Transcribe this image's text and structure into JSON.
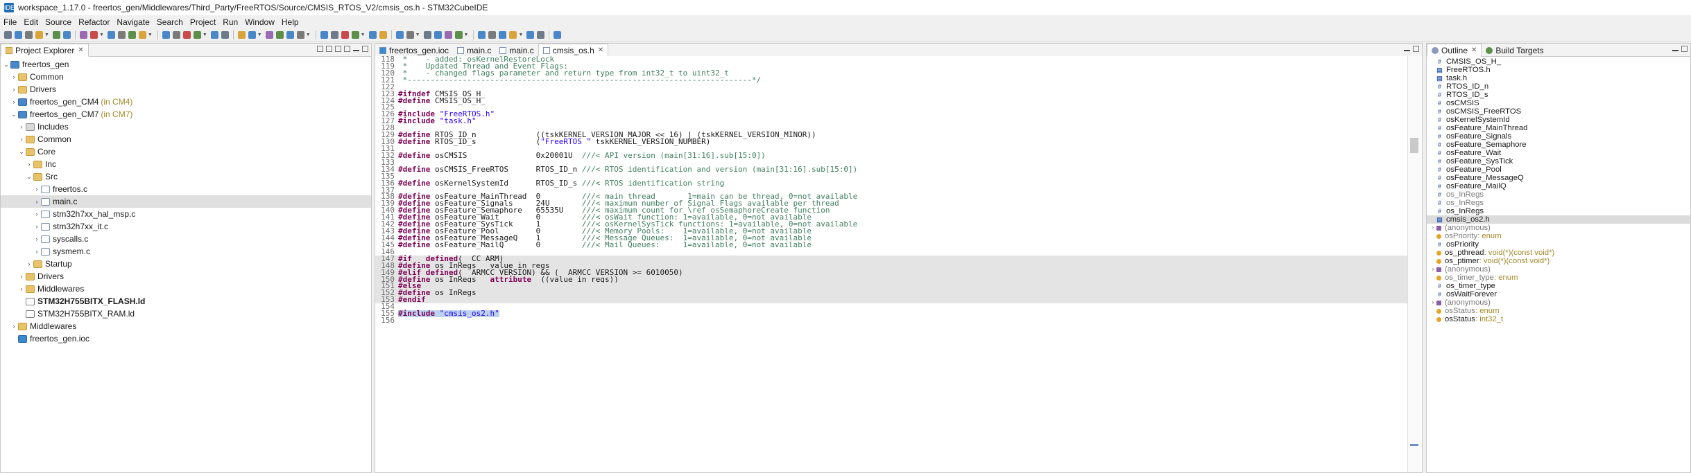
{
  "window": {
    "title": "workspace_1.17.0 - freertos_gen/Middlewares/Third_Party/FreeRTOS/Source/CMSIS_RTOS_V2/cmsis_os.h - STM32CubeIDE"
  },
  "menu": [
    "File",
    "Edit",
    "Source",
    "Refactor",
    "Navigate",
    "Search",
    "Project",
    "Run",
    "Window",
    "Help"
  ],
  "project_explorer": {
    "tab_label": "Project Explorer",
    "items": [
      {
        "label": "freertos_gen",
        "depth": 0,
        "type": "proj",
        "tw": "v",
        "suffix": ""
      },
      {
        "label": "Common",
        "depth": 1,
        "type": "folder",
        "tw": ">",
        "suffix": ""
      },
      {
        "label": "Drivers",
        "depth": 1,
        "type": "folder",
        "tw": ">",
        "suffix": ""
      },
      {
        "label": "freertos_gen_CM4",
        "depth": 1,
        "type": "proj",
        "tw": ">",
        "suffix": "(in CM4)"
      },
      {
        "label": "freertos_gen_CM7",
        "depth": 1,
        "type": "proj",
        "tw": "v",
        "suffix": "(in CM7)"
      },
      {
        "label": "Includes",
        "depth": 2,
        "type": "incfolder",
        "tw": ">",
        "suffix": ""
      },
      {
        "label": "Common",
        "depth": 2,
        "type": "folder",
        "tw": ">",
        "suffix": ""
      },
      {
        "label": "Core",
        "depth": 2,
        "type": "folder",
        "tw": "v",
        "suffix": ""
      },
      {
        "label": "Inc",
        "depth": 3,
        "type": "folder",
        "tw": ">",
        "suffix": ""
      },
      {
        "label": "Src",
        "depth": 3,
        "type": "folder",
        "tw": "v",
        "suffix": ""
      },
      {
        "label": "freertos.c",
        "depth": 4,
        "type": "cfile",
        "tw": ">",
        "suffix": ""
      },
      {
        "label": "main.c",
        "depth": 4,
        "type": "cfile",
        "tw": ">",
        "suffix": "",
        "selected": true
      },
      {
        "label": "stm32h7xx_hal_msp.c",
        "depth": 4,
        "type": "cfile",
        "tw": ">",
        "suffix": ""
      },
      {
        "label": "stm32h7xx_it.c",
        "depth": 4,
        "type": "cfile",
        "tw": ">",
        "suffix": ""
      },
      {
        "label": "syscalls.c",
        "depth": 4,
        "type": "cfile",
        "tw": ">",
        "suffix": ""
      },
      {
        "label": "sysmem.c",
        "depth": 4,
        "type": "cfile",
        "tw": ">",
        "suffix": ""
      },
      {
        "label": "Startup",
        "depth": 3,
        "type": "folder",
        "tw": ">",
        "suffix": ""
      },
      {
        "label": "Drivers",
        "depth": 2,
        "type": "folder",
        "tw": ">",
        "suffix": ""
      },
      {
        "label": "Middlewares",
        "depth": 2,
        "type": "folder",
        "tw": ">",
        "suffix": ""
      },
      {
        "label": "STM32H755BITX_FLASH.ld",
        "depth": 2,
        "type": "ldfile",
        "tw": "",
        "suffix": "",
        "bold": true
      },
      {
        "label": "STM32H755BITX_RAM.ld",
        "depth": 2,
        "type": "ldfile",
        "tw": "",
        "suffix": ""
      },
      {
        "label": "Middlewares",
        "depth": 1,
        "type": "folder",
        "tw": ">",
        "suffix": ""
      },
      {
        "label": "freertos_gen.ioc",
        "depth": 1,
        "type": "iocfile",
        "tw": "",
        "suffix": ""
      }
    ]
  },
  "editor": {
    "tabs": [
      {
        "label": "freertos_gen.ioc",
        "active": false,
        "closable": false
      },
      {
        "label": "main.c",
        "active": false,
        "closable": false
      },
      {
        "label": "main.c",
        "active": false,
        "closable": false
      },
      {
        "label": "cmsis_os.h",
        "active": true,
        "closable": true
      }
    ],
    "lines": [
      {
        "n": "118",
        "t": " *    - added: osKernelRestoreLock"
      },
      {
        "n": "119",
        "t": " *    Updated Thread and Event Flags:"
      },
      {
        "n": "120",
        "t": " *    - changed flags parameter and return type from int32_t to uint32_t"
      },
      {
        "n": "121",
        "t": " *---------------------------------------------------------------------------*/"
      },
      {
        "n": "122",
        "t": ""
      },
      {
        "n": "123",
        "t": "#ifndef CMSIS_OS_H_"
      },
      {
        "n": "124",
        "t": "#define CMSIS_OS_H_"
      },
      {
        "n": "125",
        "t": ""
      },
      {
        "n": "126",
        "t": "#include \"FreeRTOS.h\""
      },
      {
        "n": "127",
        "t": "#include \"task.h\""
      },
      {
        "n": "128",
        "t": ""
      },
      {
        "n": "129",
        "t": "#define RTOS_ID_n             ((tskKERNEL_VERSION_MAJOR << 16) | (tskKERNEL_VERSION_MINOR))"
      },
      {
        "n": "130",
        "t": "#define RTOS_ID_s             (\"FreeRTOS \" tskKERNEL_VERSION_NUMBER)"
      },
      {
        "n": "131",
        "t": ""
      },
      {
        "n": "132",
        "t": "#define osCMSIS               0x20001U  ///< API version (main[31:16].sub[15:0])"
      },
      {
        "n": "133",
        "t": ""
      },
      {
        "n": "134",
        "t": "#define osCMSIS_FreeRTOS      RTOS_ID_n ///< RTOS identification and version (main[31:16].sub[15:0])"
      },
      {
        "n": "135",
        "t": ""
      },
      {
        "n": "136",
        "t": "#define osKernelSystemId      RTOS_ID_s ///< RTOS identification string"
      },
      {
        "n": "137",
        "t": ""
      },
      {
        "n": "138",
        "t": "#define osFeature_MainThread  0         ///< main thread       1=main can be thread, 0=not available"
      },
      {
        "n": "139",
        "t": "#define osFeature_Signals     24U       ///< maximum number of Signal Flags available per thread"
      },
      {
        "n": "140",
        "t": "#define osFeature_Semaphore   65535U    ///< maximum count for \\ref osSemaphoreCreate function"
      },
      {
        "n": "141",
        "t": "#define osFeature_Wait        0         ///< osWait function: 1=available, 0=not available"
      },
      {
        "n": "142",
        "t": "#define osFeature_SysTick     1         ///< osKernelSysTick functions: 1=available, 0=not available"
      },
      {
        "n": "143",
        "t": "#define osFeature_Pool        0         ///< Memory Pools:    1=available, 0=not available"
      },
      {
        "n": "144",
        "t": "#define osFeature_MessageQ    1         ///< Message Queues:  1=available, 0=not available"
      },
      {
        "n": "145",
        "t": "#define osFeature_MailQ       0         ///< Mail Queues:     1=available, 0=not available"
      },
      {
        "n": "146",
        "t": ""
      },
      {
        "n": "147",
        "t": "#if   defined(__CC_ARM)"
      },
      {
        "n": "148",
        "t": "#define os_InRegs __value_in_regs"
      },
      {
        "n": "149",
        "t": "#elif defined(__ARMCC_VERSION) && (__ARMCC_VERSION >= 6010050)"
      },
      {
        "n": "150",
        "t": "#define os_InRegs __attribute__((value_in_regs))"
      },
      {
        "n": "151",
        "t": "#else"
      },
      {
        "n": "152",
        "t": "#define os_InRegs"
      },
      {
        "n": "153",
        "t": "#endif"
      },
      {
        "n": "154",
        "t": ""
      },
      {
        "n": "155",
        "t": "#include \"cmsis_os2.h\""
      },
      {
        "n": "156",
        "t": ""
      }
    ]
  },
  "outline": {
    "tabs": [
      "Outline",
      "Build Targets"
    ],
    "items": [
      {
        "icon": "#",
        "label": "CMSIS_OS_H_",
        "type": "",
        "gray": false
      },
      {
        "icon": "inc",
        "label": "FreeRTOS.h",
        "type": "",
        "gray": false
      },
      {
        "icon": "inc",
        "label": "task.h",
        "type": "",
        "gray": false
      },
      {
        "icon": "#",
        "label": "RTOS_ID_n",
        "type": "",
        "gray": false
      },
      {
        "icon": "#",
        "label": "RTOS_ID_s",
        "type": "",
        "gray": false
      },
      {
        "icon": "#",
        "label": "osCMSIS",
        "type": "",
        "gray": false
      },
      {
        "icon": "#",
        "label": "osCMSIS_FreeRTOS",
        "type": "",
        "gray": false
      },
      {
        "icon": "#",
        "label": "osKernelSystemId",
        "type": "",
        "gray": false
      },
      {
        "icon": "#",
        "label": "osFeature_MainThread",
        "type": "",
        "gray": false
      },
      {
        "icon": "#",
        "label": "osFeature_Signals",
        "type": "",
        "gray": false
      },
      {
        "icon": "#",
        "label": "osFeature_Semaphore",
        "type": "",
        "gray": false
      },
      {
        "icon": "#",
        "label": "osFeature_Wait",
        "type": "",
        "gray": false
      },
      {
        "icon": "#",
        "label": "osFeature_SysTick",
        "type": "",
        "gray": false
      },
      {
        "icon": "#",
        "label": "osFeature_Pool",
        "type": "",
        "gray": false
      },
      {
        "icon": "#",
        "label": "osFeature_MessageQ",
        "type": "",
        "gray": false
      },
      {
        "icon": "#",
        "label": "osFeature_MailQ",
        "type": "",
        "gray": false
      },
      {
        "icon": "#",
        "label": "os_InRegs",
        "type": "",
        "gray": true
      },
      {
        "icon": "#",
        "label": "os_InRegs",
        "type": "",
        "gray": true
      },
      {
        "icon": "#",
        "label": "os_InRegs",
        "type": "",
        "gray": false
      },
      {
        "icon": "inc",
        "label": "cmsis_os2.h",
        "type": "",
        "gray": false,
        "selected": true
      },
      {
        "icon": "str",
        "label": "(anonymous)",
        "type": "",
        "gray": true,
        "tw": ">"
      },
      {
        "icon": "tdf",
        "label": "osPriority",
        "type": " : enum",
        "gray": true
      },
      {
        "icon": "#",
        "label": "osPriority",
        "type": "",
        "gray": false
      },
      {
        "icon": "tdf",
        "label": "os_pthread",
        "type": " : void(*)(const void*)",
        "gray": false
      },
      {
        "icon": "tdf",
        "label": "os_ptimer",
        "type": " : void(*)(const void*)",
        "gray": false
      },
      {
        "icon": "str",
        "label": "(anonymous)",
        "type": "",
        "gray": true,
        "tw": ">"
      },
      {
        "icon": "tdf",
        "label": "os_timer_type",
        "type": " : enum",
        "gray": true
      },
      {
        "icon": "#",
        "label": "os_timer_type",
        "type": "",
        "gray": false
      },
      {
        "icon": "#",
        "label": "osWaitForever",
        "type": "",
        "gray": false
      },
      {
        "icon": "str",
        "label": "(anonymous)",
        "type": "",
        "gray": true,
        "tw": ">"
      },
      {
        "icon": "tdf",
        "label": "osStatus",
        "type": " : enum",
        "gray": true
      },
      {
        "icon": "tdf",
        "label": "osStatus",
        "type": " : int32_t",
        "gray": false
      }
    ]
  },
  "colors": {
    "keyword": "#7f0055",
    "comment": "#3f7f5f",
    "string": "#2a00ff",
    "selection": "#bcd3ee",
    "inactive_block": "#e4e4e4"
  }
}
